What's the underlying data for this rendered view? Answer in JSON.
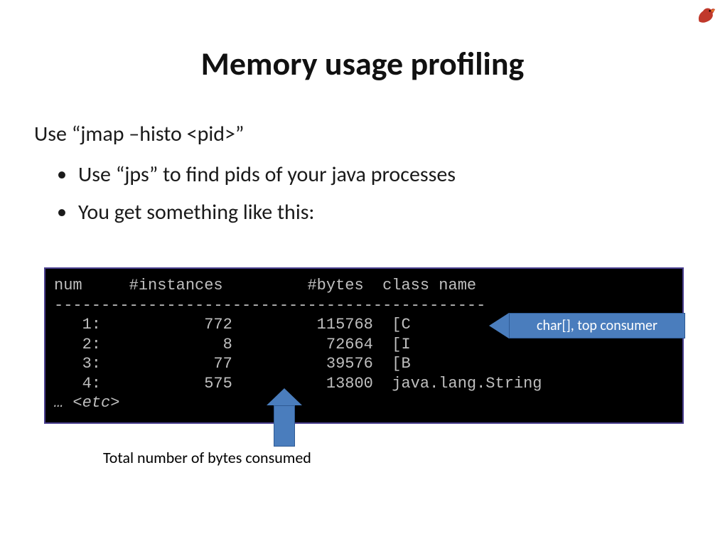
{
  "title": "Memory usage profiling",
  "line1": "Use “jmap –histo <pid>”",
  "bullets": [
    "Use “jps” to find pids of your java processes",
    "You get something like this:"
  ],
  "terminal": {
    "header": "num     #instances         #bytes  class name",
    "divider": "----------------------------------------------",
    "rows": [
      "   1:           772         115768  [C",
      "   2:             8          72664  [I",
      "   3:            77          39576  [B",
      "   4:           575          13800  java.lang.String"
    ],
    "etc": "… <etc>"
  },
  "callout_right": "char[], top consumer",
  "callout_bottom": "Total number of bytes consumed",
  "logo_alt": "rooster-logo"
}
